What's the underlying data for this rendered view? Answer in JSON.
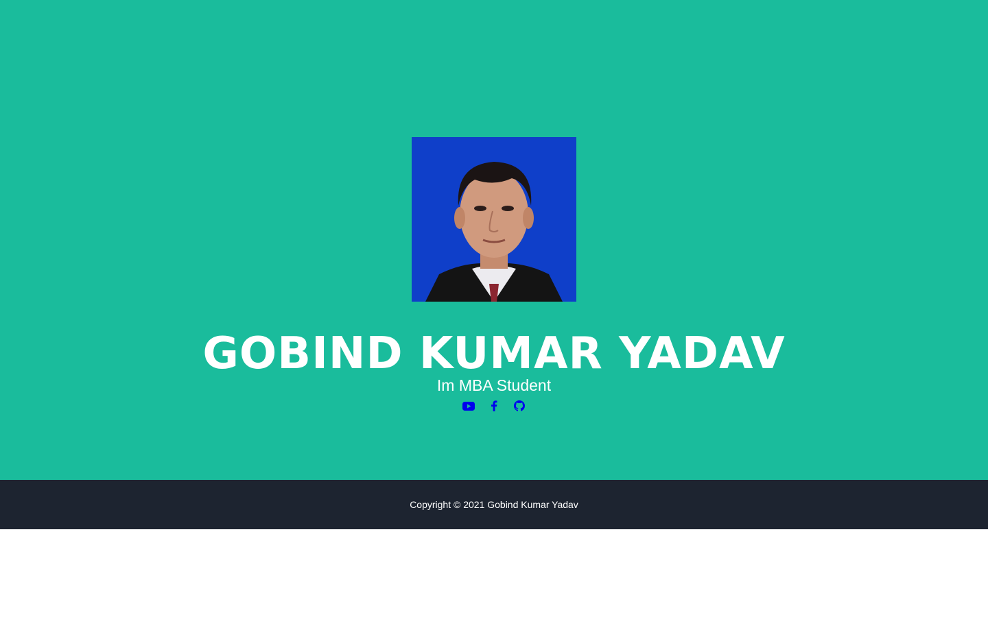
{
  "hero": {
    "background_color": "#1abc9c",
    "photo": {
      "alt": "profile-photo",
      "background_color": "#0f3fc9"
    },
    "name": "GOBIND KUMAR YADAV",
    "tagline": "Im MBA Student",
    "social_links": [
      {
        "icon": "youtube-icon",
        "label": "YouTube"
      },
      {
        "icon": "facebook-icon",
        "label": "Facebook"
      },
      {
        "icon": "github-icon",
        "label": "GitHub"
      }
    ],
    "link_color": "#0000ee"
  },
  "footer": {
    "background_color": "#1d2430",
    "copyright": "Copyright © 2021 Gobind Kumar Yadav"
  }
}
